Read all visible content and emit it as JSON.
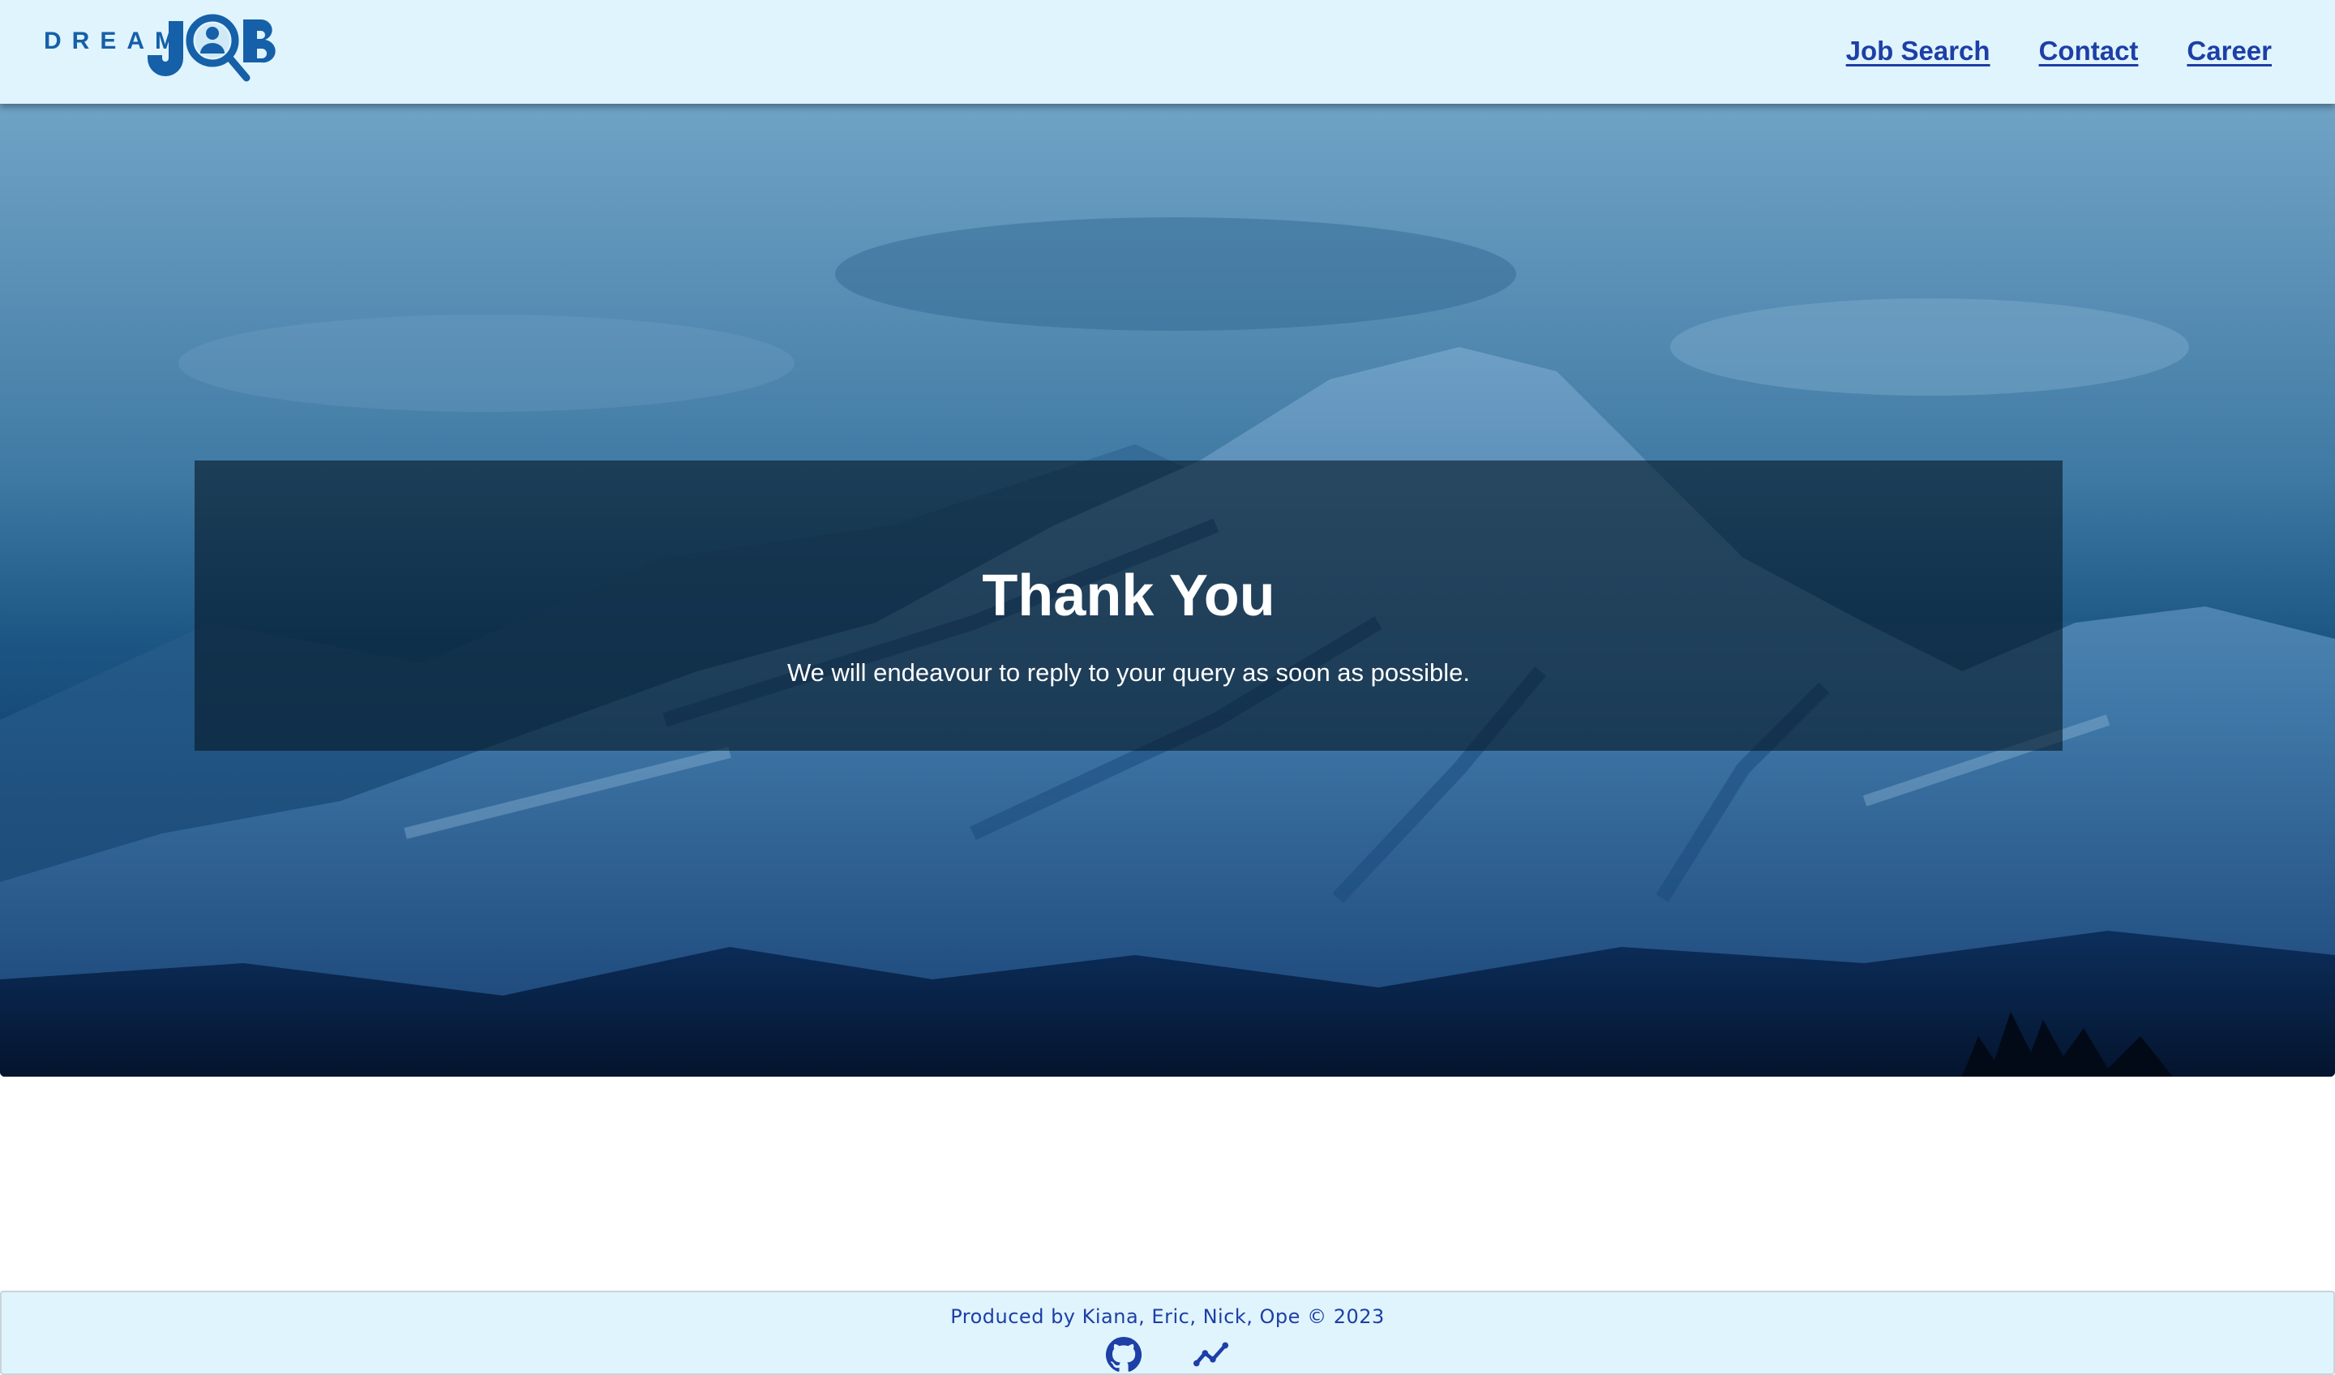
{
  "header": {
    "logo_word": "DREAM",
    "logo_job": "JOB",
    "nav": [
      {
        "label": "Job Search"
      },
      {
        "label": "Contact"
      },
      {
        "label": "Career"
      }
    ]
  },
  "hero": {
    "title": "Thank You",
    "message": "We will endeavour to reply to your query as soon as possible."
  },
  "footer": {
    "credit": "Produced by Kiana, Eric, Nick, Ope © 2023",
    "icons": [
      "github-icon",
      "analytics-icon"
    ]
  },
  "colors": {
    "header_bg": "#e0f4fd",
    "brand": "#1560a8",
    "link": "#1d3fa6"
  }
}
